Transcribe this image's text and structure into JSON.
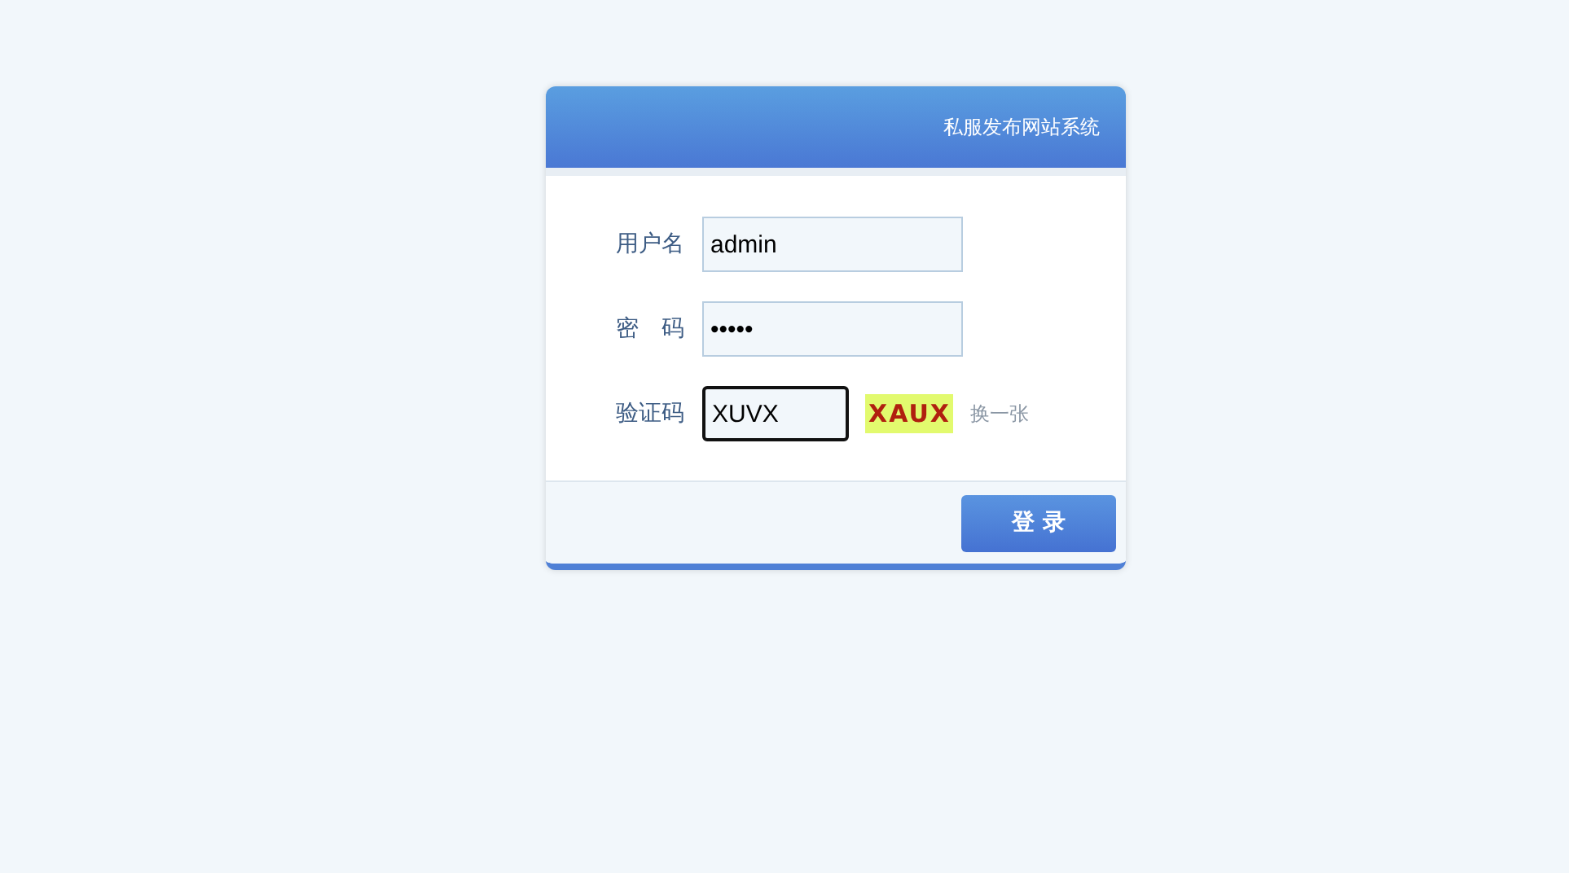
{
  "header": {
    "title": "私服发布网站系统"
  },
  "fields": [
    {
      "kind": "text",
      "label": "用户名",
      "value": "admin",
      "focused": false
    },
    {
      "kind": "text",
      "label": "密　码",
      "value": "•••••",
      "focused": false
    },
    {
      "kind": "captcha",
      "label": "验证码",
      "value": "XUVX",
      "focused": true,
      "captcha": "XAUX",
      "refresh": "换一张"
    }
  ],
  "submit": "登 录"
}
